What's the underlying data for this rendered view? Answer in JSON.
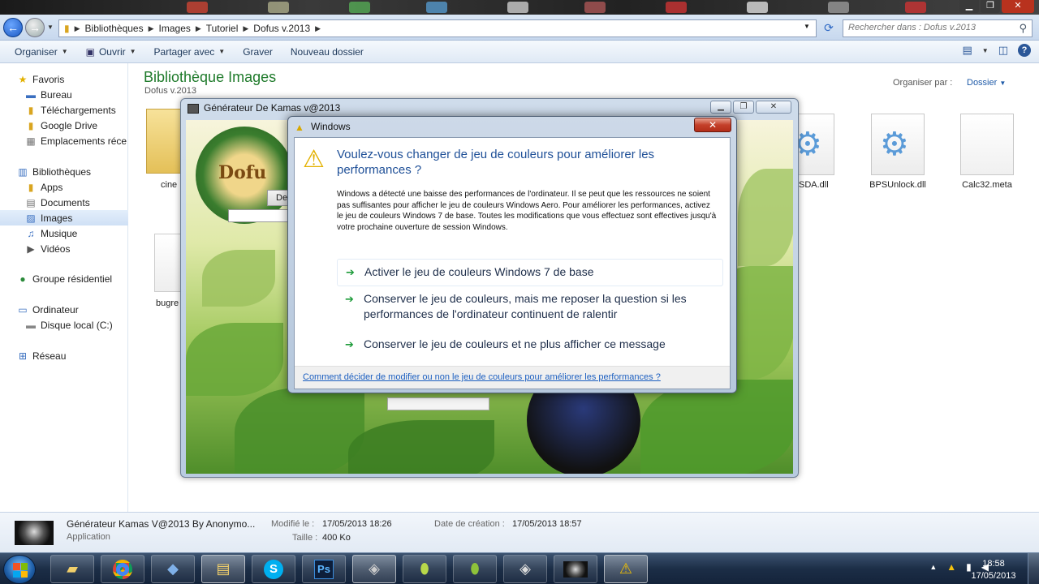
{
  "explorer": {
    "breadcrumb": [
      "Bibliothèques",
      "Images",
      "Tutoriel",
      "Dofus v.2013"
    ],
    "search_placeholder": "Rechercher dans : Dofus v.2013",
    "toolbar": {
      "organize": "Organiser",
      "open": "Ouvrir",
      "share": "Partager avec",
      "burn": "Graver",
      "new_folder": "Nouveau dossier"
    },
    "nav": {
      "favorites": "Favoris",
      "desktop": "Bureau",
      "downloads": "Téléchargements",
      "gdrive": "Google Drive",
      "recent": "Emplacements réce",
      "libraries": "Bibliothèques",
      "apps": "Apps",
      "documents": "Documents",
      "images": "Images",
      "music": "Musique",
      "videos": "Vidéos",
      "homegroup": "Groupe résidentiel",
      "computer": "Ordinateur",
      "disk": "Disque local (C:)",
      "network": "Réseau"
    },
    "library_title": "Bibliothèque Images",
    "library_sub": "Dofus v.2013",
    "arrange_label": "Organiser par :",
    "arrange_value": "Dossier",
    "files": {
      "f1": "cine",
      "f2": "bugre",
      "f3": "SDA.dll",
      "f4": "BPSUnlock.dll",
      "f5": "Calc32.meta"
    }
  },
  "kamas_window": {
    "title": "Générateur De Kamas v@2013",
    "logo_text": "Dofu",
    "button_fragment": "De"
  },
  "dialog": {
    "title": "Windows",
    "heading": "Voulez-vous changer de jeu de couleurs pour améliorer les performances ?",
    "body": "Windows a détecté une baisse des performances de l'ordinateur. Il se peut que les ressources ne soient pas suffisantes pour afficher le jeu de couleurs Windows Aero. Pour améliorer les performances, activez le jeu de couleurs Windows 7 de base. Toutes les modifications que vous effectuez sont effectives jusqu'à votre prochaine ouverture de session Windows.",
    "option1": "Activer le jeu de couleurs Windows 7 de base",
    "option2": "Conserver le jeu de couleurs, mais me reposer la question si les performances de l'ordinateur continuent de ralentir",
    "option3": "Conserver le jeu de couleurs et ne plus afficher ce message",
    "help_link": "Comment décider de modifier ou non le jeu de couleurs pour améliorer les performances ?"
  },
  "details": {
    "name": "Générateur Kamas V@2013 By Anonymo...",
    "type": "Application",
    "modified_label": "Modifié le :",
    "modified_value": "17/05/2013 18:26",
    "created_label": "Date de création :",
    "created_value": "17/05/2013 18:57",
    "size_label": "Taille :",
    "size_value": "400 Ko"
  },
  "taskbar": {
    "time": "18:58",
    "date": "17/05/2013",
    "ps_label": "Ps"
  },
  "colors": {
    "accent_green": "#1e7a2a",
    "link_blue": "#1c5fc0",
    "heading_blue": "#1e4f97",
    "warning_yellow": "#e3b100"
  }
}
